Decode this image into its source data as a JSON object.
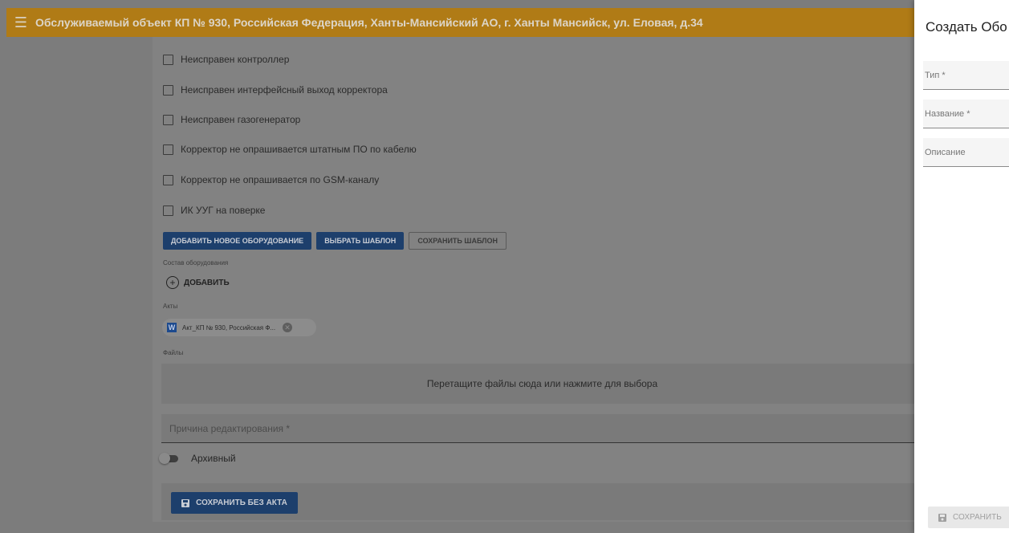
{
  "header": {
    "title": "Обслуживаемый объект КП № 930, Российская Федерация, Ханты-Мансийский АО, г. Ханты Мансийск, ул. Еловая, д.34"
  },
  "checkboxes": [
    {
      "label": "Неисправен контроллер",
      "checked": false
    },
    {
      "label": "Неисправен интерфейсный выход корректора",
      "checked": false
    },
    {
      "label": "Неисправен газогенератор",
      "checked": false
    },
    {
      "label": "Корректор не опрашивается штатным ПО по кабелю",
      "checked": false
    },
    {
      "label": "Корректор не опрашивается по GSM-каналу",
      "checked": false
    },
    {
      "label": "ИК УУГ на поверке",
      "checked": false
    }
  ],
  "actions": {
    "add_equipment": "ДОБАВИТЬ НОВОЕ ОБОРУДОВАНИЕ",
    "choose_template": "ВЫБРАТЬ ШАБЛОН",
    "save_template": "СОХРАНИТЬ ШАБЛОН"
  },
  "equipment": {
    "label": "Состав оборудования",
    "add_label": "ДОБАВИТЬ"
  },
  "acts": {
    "label": "Акты",
    "chip_text": "Акт_КП № 930, Российская Ф...",
    "chip_icon": "W"
  },
  "files": {
    "label": "Файлы",
    "dropzone_text": "Перетащите файлы сюда или нажмите для выбора"
  },
  "reason": {
    "placeholder": "Причина редактирования *"
  },
  "archive": {
    "label": "Архивный",
    "enabled": false
  },
  "footer": {
    "save_label": "СОХРАНИТЬ БЕЗ АКТА"
  },
  "drawer": {
    "title": "Создать Обо",
    "fields": [
      {
        "placeholder": "Тип *"
      },
      {
        "placeholder": "Название *"
      },
      {
        "placeholder": "Описание"
      }
    ],
    "save_label": "СОХРАНИТЬ"
  },
  "colors": {
    "topbar": "#b07b16",
    "primary": "#1d3f6c",
    "overlay": "#7c7c7c"
  }
}
